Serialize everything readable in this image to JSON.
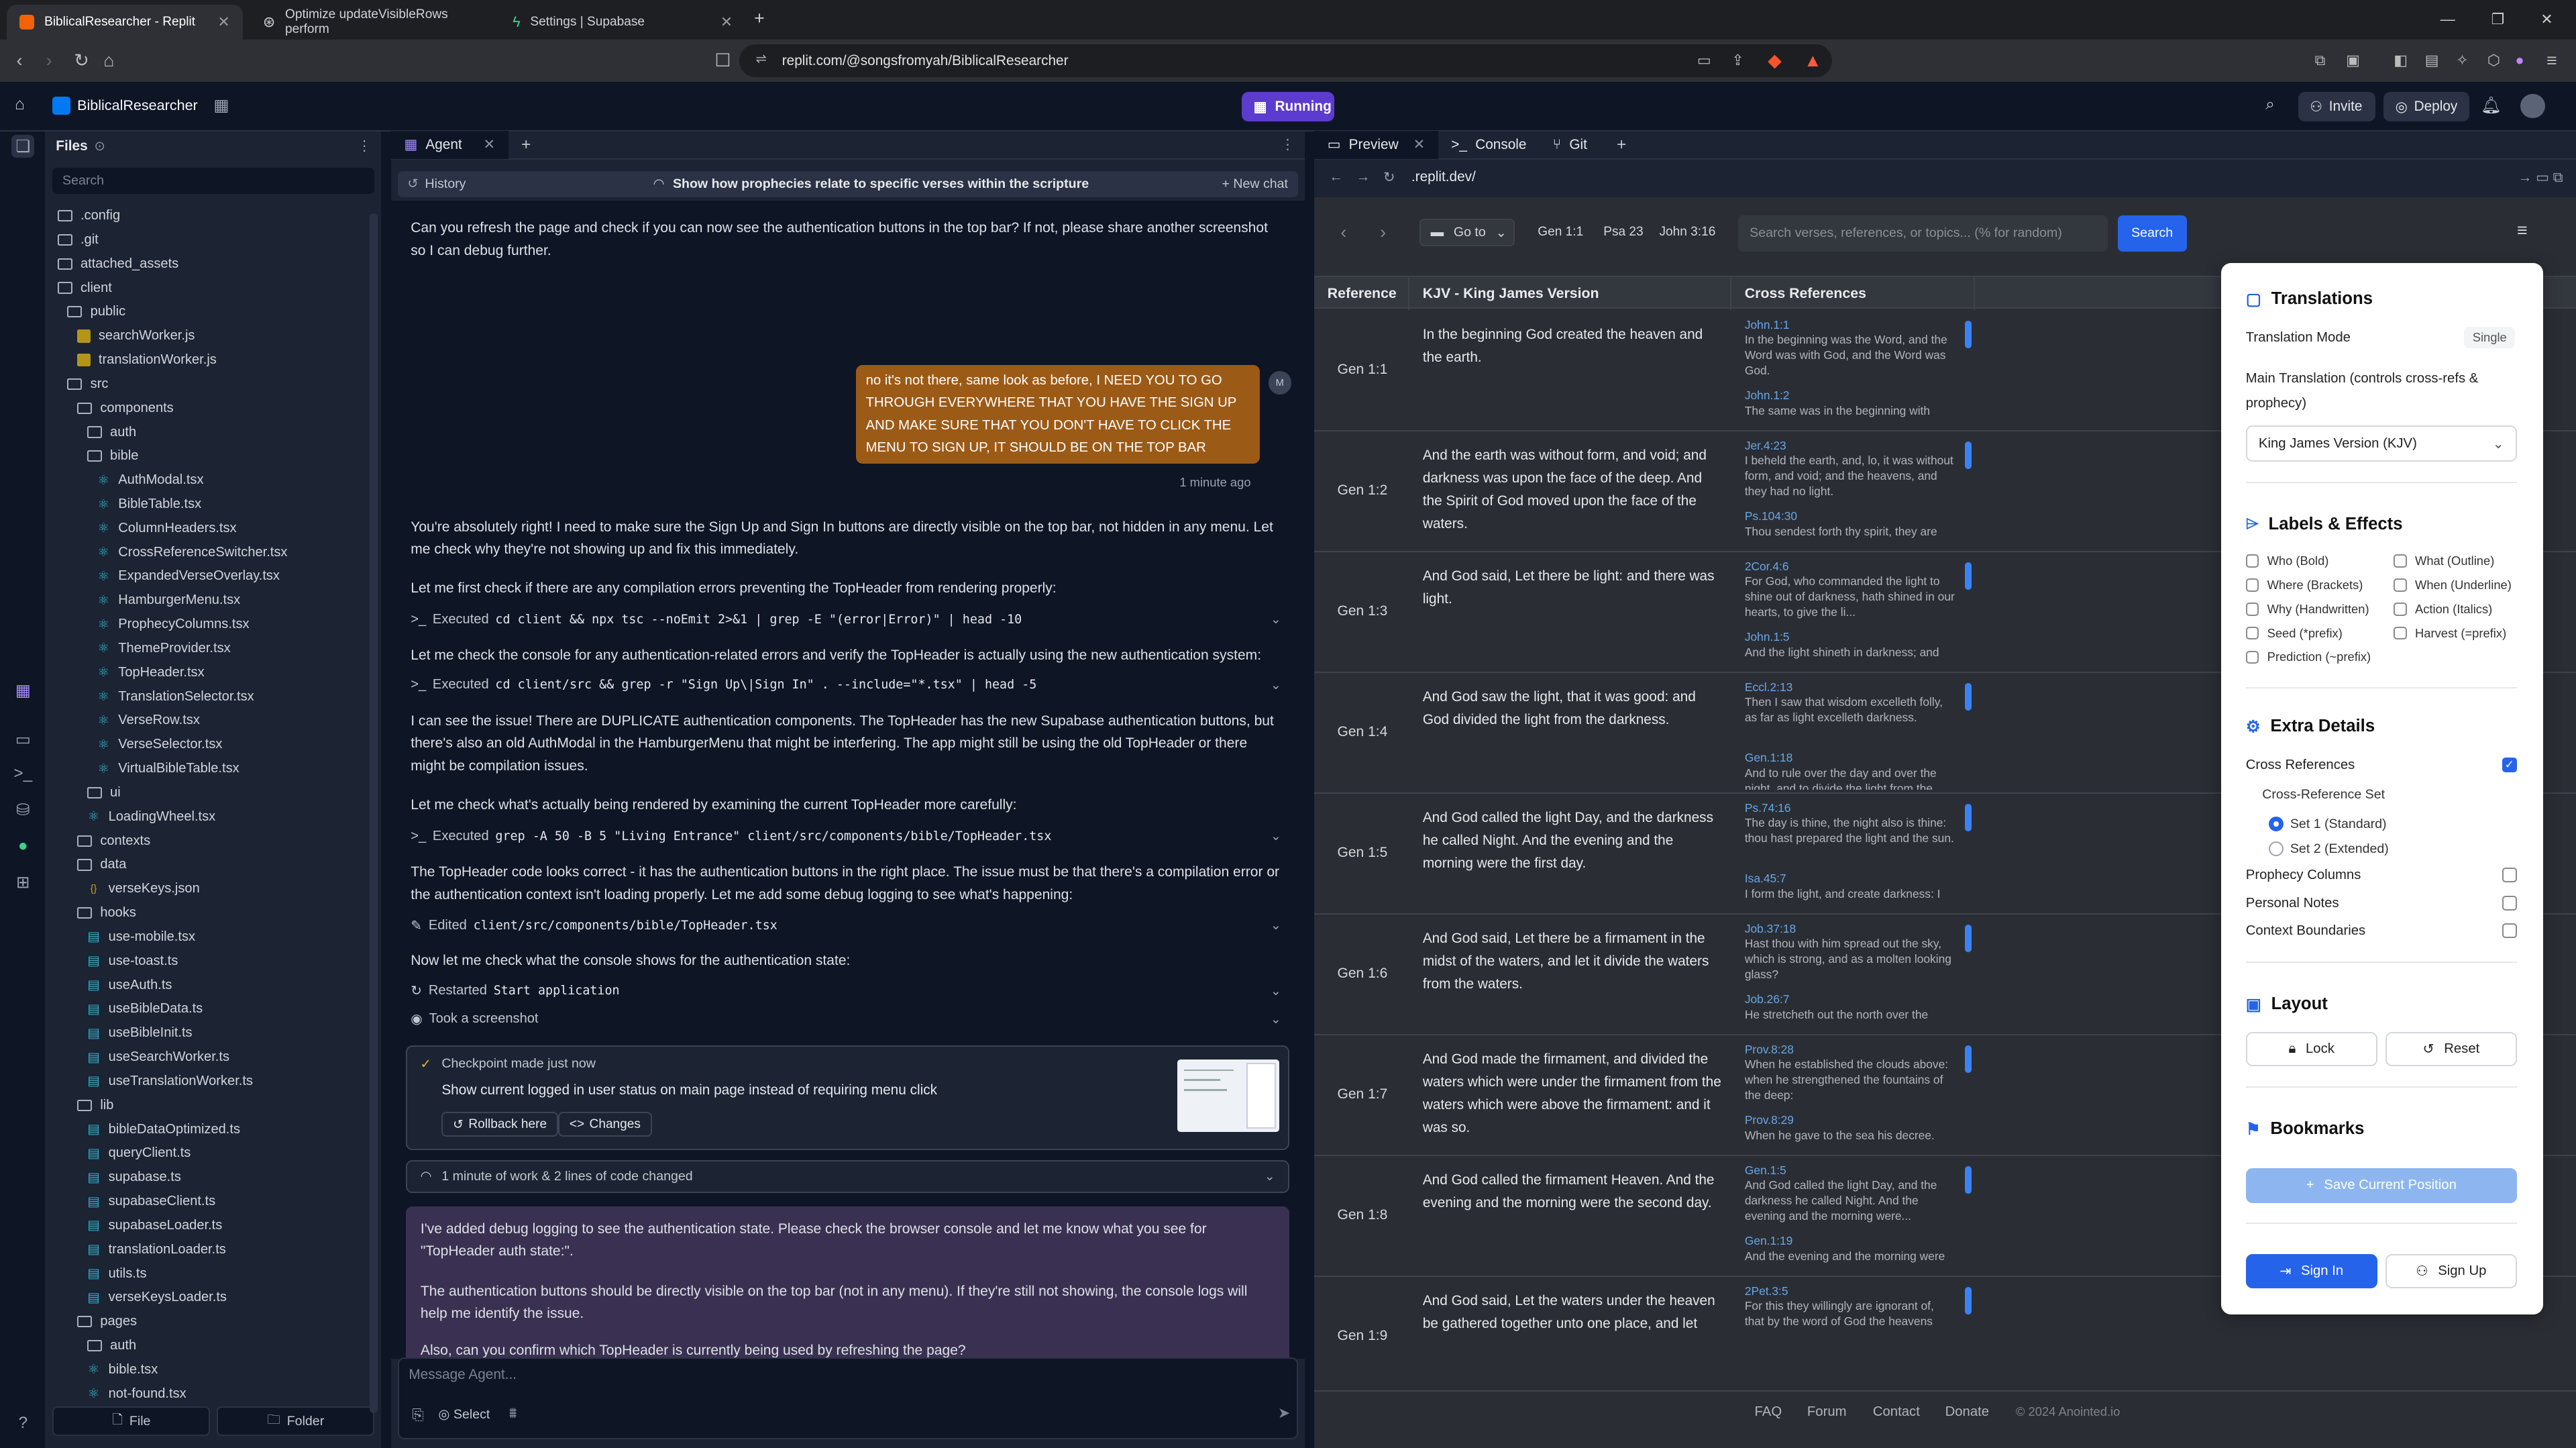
{
  "browser": {
    "tabs": [
      {
        "title": "BiblicalResearcher - Replit"
      },
      {
        "title": "Optimize updateVisibleRows perform"
      },
      {
        "title": "Settings | Supabase"
      }
    ],
    "url": "replit.com/@songsfromyah/BiblicalResearcher"
  },
  "header": {
    "project_name": "BiblicalResearcher",
    "run_label": "Running",
    "invite_label": "Invite",
    "deploy_label": "Deploy"
  },
  "files": {
    "title": "Files",
    "search_placeholder": "Search",
    "new_file": "File",
    "new_folder": "Folder",
    "tree": [
      {
        "name": ".config",
        "type": "folder",
        "depth": 0
      },
      {
        "name": ".git",
        "type": "folder",
        "depth": 0
      },
      {
        "name": "attached_assets",
        "type": "folder",
        "depth": 0
      },
      {
        "name": "client",
        "type": "folder",
        "depth": 0
      },
      {
        "name": "public",
        "type": "folder",
        "depth": 1
      },
      {
        "name": "searchWorker.js",
        "type": "js",
        "depth": 2
      },
      {
        "name": "translationWorker.js",
        "type": "js",
        "depth": 2
      },
      {
        "name": "src",
        "type": "folder",
        "depth": 1
      },
      {
        "name": "components",
        "type": "folder",
        "depth": 2
      },
      {
        "name": "auth",
        "type": "folder",
        "depth": 3
      },
      {
        "name": "bible",
        "type": "folder",
        "depth": 3
      },
      {
        "name": "AuthModal.tsx",
        "type": "react",
        "depth": 4
      },
      {
        "name": "BibleTable.tsx",
        "type": "react",
        "depth": 4
      },
      {
        "name": "ColumnHeaders.tsx",
        "type": "react",
        "depth": 4
      },
      {
        "name": "CrossReferenceSwitcher.tsx",
        "type": "react",
        "depth": 4
      },
      {
        "name": "ExpandedVerseOverlay.tsx",
        "type": "react",
        "depth": 4
      },
      {
        "name": "HamburgerMenu.tsx",
        "type": "react",
        "depth": 4
      },
      {
        "name": "ProphecyColumns.tsx",
        "type": "react",
        "depth": 4
      },
      {
        "name": "ThemeProvider.tsx",
        "type": "react",
        "depth": 4
      },
      {
        "name": "TopHeader.tsx",
        "type": "react",
        "depth": 4
      },
      {
        "name": "TranslationSelector.tsx",
        "type": "react",
        "depth": 4
      },
      {
        "name": "VerseRow.tsx",
        "type": "react",
        "depth": 4
      },
      {
        "name": "VerseSelector.tsx",
        "type": "react",
        "depth": 4
      },
      {
        "name": "VirtualBibleTable.tsx",
        "type": "react",
        "depth": 4
      },
      {
        "name": "ui",
        "type": "folder",
        "depth": 3
      },
      {
        "name": "LoadingWheel.tsx",
        "type": "react",
        "depth": 3
      },
      {
        "name": "contexts",
        "type": "folder",
        "depth": 2
      },
      {
        "name": "data",
        "type": "folder",
        "depth": 2
      },
      {
        "name": "verseKeys.json",
        "type": "json",
        "depth": 3
      },
      {
        "name": "hooks",
        "type": "folder",
        "depth": 2
      },
      {
        "name": "use-mobile.tsx",
        "type": "ts",
        "depth": 3
      },
      {
        "name": "use-toast.ts",
        "type": "ts",
        "depth": 3
      },
      {
        "name": "useAuth.ts",
        "type": "ts",
        "depth": 3
      },
      {
        "name": "useBibleData.ts",
        "type": "ts",
        "depth": 3
      },
      {
        "name": "useBibleInit.ts",
        "type": "ts",
        "depth": 3
      },
      {
        "name": "useSearchWorker.ts",
        "type": "ts",
        "depth": 3
      },
      {
        "name": "useTranslationWorker.ts",
        "type": "ts",
        "depth": 3
      },
      {
        "name": "lib",
        "type": "folder",
        "depth": 2
      },
      {
        "name": "bibleDataOptimized.ts",
        "type": "ts",
        "depth": 3
      },
      {
        "name": "queryClient.ts",
        "type": "ts",
        "depth": 3
      },
      {
        "name": "supabase.ts",
        "type": "ts",
        "depth": 3
      },
      {
        "name": "supabaseClient.ts",
        "type": "ts",
        "depth": 3
      },
      {
        "name": "supabaseLoader.ts",
        "type": "ts",
        "depth": 3
      },
      {
        "name": "translationLoader.ts",
        "type": "ts",
        "depth": 3
      },
      {
        "name": "utils.ts",
        "type": "ts",
        "depth": 3
      },
      {
        "name": "verseKeysLoader.ts",
        "type": "ts",
        "depth": 3
      },
      {
        "name": "pages",
        "type": "folder",
        "depth": 2
      },
      {
        "name": "auth",
        "type": "folder",
        "depth": 3
      },
      {
        "name": "bible.tsx",
        "type": "react",
        "depth": 3
      },
      {
        "name": "not-found.tsx",
        "type": "react",
        "depth": 3
      }
    ]
  },
  "agent": {
    "tab_label": "Agent",
    "history_label": "History",
    "chat_title": "Show how prophecies relate to specific verses within the scripture",
    "new_chat": "New chat",
    "intro": "Can you refresh the page and check if you can now see the authentication buttons in the top bar? If not, please share another screenshot so I can debug further.",
    "user_msg": "no it's not there, same look as before, I NEED YOU TO GO THROUGH EVERYWHERE THAT YOU HAVE THE SIGN UP AND MAKE SURE THAT YOU DON'T HAVE TO CLICK THE MENU TO SIGN UP, IT SHOULD BE ON THE TOP BAR",
    "user_time": "1 minute ago",
    "p1": "You're absolutely right! I need to make sure the Sign Up and Sign In buttons are directly visible on the top bar, not hidden in any menu. Let me check why they're not showing up and fix this immediately.",
    "p2": "Let me first check if there are any compilation errors preventing the TopHeader from rendering properly:",
    "c1_label": "Executed",
    "c1": "cd client && npx tsc --noEmit 2>&1 | grep -E \"(error|Error)\" | head -10",
    "p3": "Let me check the console for any authentication-related errors and verify the TopHeader is actually using the new authentication system:",
    "c2_label": "Executed",
    "c2": "cd client/src && grep -r \"Sign Up\\|Sign In\" . --include=\"*.tsx\" | head -5",
    "p4": "I can see the issue! There are DUPLICATE authentication components. The TopHeader has the new Supabase authentication buttons, but there's also an old AuthModal in the HamburgerMenu that might be interfering. The app might still be using the old TopHeader or there might be compilation issues.",
    "p5": "Let me check what's actually being rendered by examining the current TopHeader more carefully:",
    "c3_label": "Executed",
    "c3": "grep -A 50 -B 5 \"Living Entrance\" client/src/components/bible/TopHeader.tsx",
    "p6": "The TopHeader code looks correct - it has the authentication buttons in the right place. The issue must be that there's a compilation error or the authentication context isn't loading properly. Let me add some debug logging to see what's happening:",
    "c4_label": "Edited",
    "c4": "client/src/components/bible/TopHeader.tsx",
    "p7": "Now let me check what the console shows for the authentication state:",
    "c5_label": "Restarted",
    "c5": "Start application",
    "c6": "Took a screenshot",
    "checkpoint_title": "Checkpoint made just now",
    "checkpoint_desc": "Show current logged in user status on main page instead of requiring menu click",
    "rollback": "Rollback here",
    "changes": "Changes",
    "work_summary": "1 minute of work & 2 lines of code changed",
    "a1": "I've added debug logging to see the authentication state. Please check the browser console and let me know what you see for \"TopHeader auth state:\".",
    "a2": "The authentication buttons should be directly visible on the top bar (not in any menu). If they're still not showing, the console logs will help me identify the issue.",
    "a3": "Also, can you confirm which TopHeader is currently being used by refreshing the page?",
    "input_placeholder": "Message Agent...",
    "select_label": "Select"
  },
  "preview": {
    "tabs": [
      "Preview",
      "Console",
      "Git"
    ],
    "url": ".replit.dev/",
    "goto_label": "Go to",
    "quick_refs": [
      "Gen 1:1",
      "Psa 23",
      "John 3:16"
    ],
    "search_placeholder": "Search verses, references, or topics... (% for random)",
    "search_button": "Search",
    "columns": {
      "reference": "Reference",
      "kjv": "KJV - King James Version",
      "cross": "Cross References"
    },
    "rows": [
      {
        "ref": "Gen 1:1",
        "text": "In the beginning God created the heaven and the earth.",
        "xrefs": [
          {
            "r": "John.1:1",
            "t": "In the beginning was the Word, and the Word was with God, and the Word was God."
          },
          {
            "r": "John.1:2",
            "t": "The same was in the beginning with"
          }
        ]
      },
      {
        "ref": "Gen 1:2",
        "text": "And the earth was without form, and void; and darkness was upon the face of the deep. And the Spirit of God moved upon the face of the waters.",
        "xrefs": [
          {
            "r": "Jer.4:23",
            "t": "I beheld the earth, and, lo, it was without form, and void; and the heavens, and they had no light."
          },
          {
            "r": "Ps.104:30",
            "t": "Thou sendest forth thy spirit, they are"
          }
        ]
      },
      {
        "ref": "Gen 1:3",
        "text": "And God said, Let there be light: and there was light.",
        "xrefs": [
          {
            "r": "2Cor.4:6",
            "t": "For God, who commanded the light to shine out of darkness, hath shined in our hearts, to give the li..."
          },
          {
            "r": "John.1:5",
            "t": "And the light shineth in darkness; and"
          }
        ]
      },
      {
        "ref": "Gen 1:4",
        "text": "And God saw the light, that it was good: and God divided the light from the darkness.",
        "xrefs": [
          {
            "r": "Eccl.2:13",
            "t": "Then I saw that wisdom excelleth folly, as far as light excelleth darkness."
          },
          {
            "r": "Gen.1:18",
            "t": "And to rule over the day and over the night, and to divide the light from the"
          }
        ]
      },
      {
        "ref": "Gen 1:5",
        "text": "And God called the light Day, and the darkness he called Night. And the evening and the morning were the first day.",
        "xrefs": [
          {
            "r": "Ps.74:16",
            "t": "The day is thine, the night also is thine: thou hast prepared the light and the sun."
          },
          {
            "r": "Isa.45:7",
            "t": "I form the light, and create darkness: I"
          }
        ]
      },
      {
        "ref": "Gen 1:6",
        "text": "And God said, Let there be a firmament in the midst of the waters, and let it divide the waters from the waters.",
        "xrefs": [
          {
            "r": "Job.37:18",
            "t": "Hast thou with him spread out the sky, which is strong, and as a molten looking glass?"
          },
          {
            "r": "Job.26:7",
            "t": "He stretcheth out the north over the"
          }
        ]
      },
      {
        "ref": "Gen 1:7",
        "text": "And God made the firmament, and divided the waters which were under the firmament from the waters which were above the firmament: and it was so.",
        "xrefs": [
          {
            "r": "Prov.8:28",
            "t": "When he established the clouds above: when he strengthened the fountains of the deep:"
          },
          {
            "r": "Prov.8:29",
            "t": "When he gave to the sea his decree."
          }
        ]
      },
      {
        "ref": "Gen 1:8",
        "text": "And God called the firmament Heaven. And the evening and the morning were the second day.",
        "xrefs": [
          {
            "r": "Gen.1:5",
            "t": "And God called the light Day, and the darkness he called Night. And the evening and the morning were..."
          },
          {
            "r": "Gen.1:19",
            "t": "And the evening and the morning were"
          }
        ]
      },
      {
        "ref": "Gen 1:9",
        "text": "And God said, Let the waters under the heaven be gathered together unto one place, and let",
        "xrefs": [
          {
            "r": "2Pet.3:5",
            "t": "For this they willingly are ignorant of, that by the word of God the heavens"
          }
        ]
      }
    ],
    "footer": {
      "faq": "FAQ",
      "forum": "Forum",
      "contact": "Contact",
      "donate": "Donate",
      "copyright": "© 2024 Anointed.io"
    }
  },
  "settings": {
    "translations_title": "Translations",
    "mode_label": "Translation Mode",
    "mode_value": "Single",
    "main_label": "Main Translation (controls cross-refs & prophecy)",
    "main_value": "King James Version (KJV)",
    "labels_title": "Labels & Effects",
    "labels": [
      "Who (Bold)",
      "What (Outline)",
      "Where (Brackets)",
      "When (Underline)",
      "Why (Handwritten)",
      "Action (Italics)",
      "Seed (*prefix)",
      "Harvest (=prefix)",
      "Prediction (~prefix)"
    ],
    "extra_title": "Extra Details",
    "cross_refs": "Cross References",
    "cross_set": "Cross-Reference Set",
    "set1": "Set 1 (Standard)",
    "set2": "Set 2 (Extended)",
    "prophecy": "Prophecy Columns",
    "notes": "Personal Notes",
    "context": "Context Boundaries",
    "layout_title": "Layout",
    "lock": "Lock",
    "reset": "Reset",
    "bookmarks_title": "Bookmarks",
    "save_position": "Save Current Position",
    "sign_in": "Sign In",
    "sign_up": "Sign Up"
  },
  "colors": {
    "accent": "#2563eb",
    "replit_run": "#5c3bcf",
    "user_bubble": "#9c5a17",
    "agent_bubble": "#3a3152"
  }
}
